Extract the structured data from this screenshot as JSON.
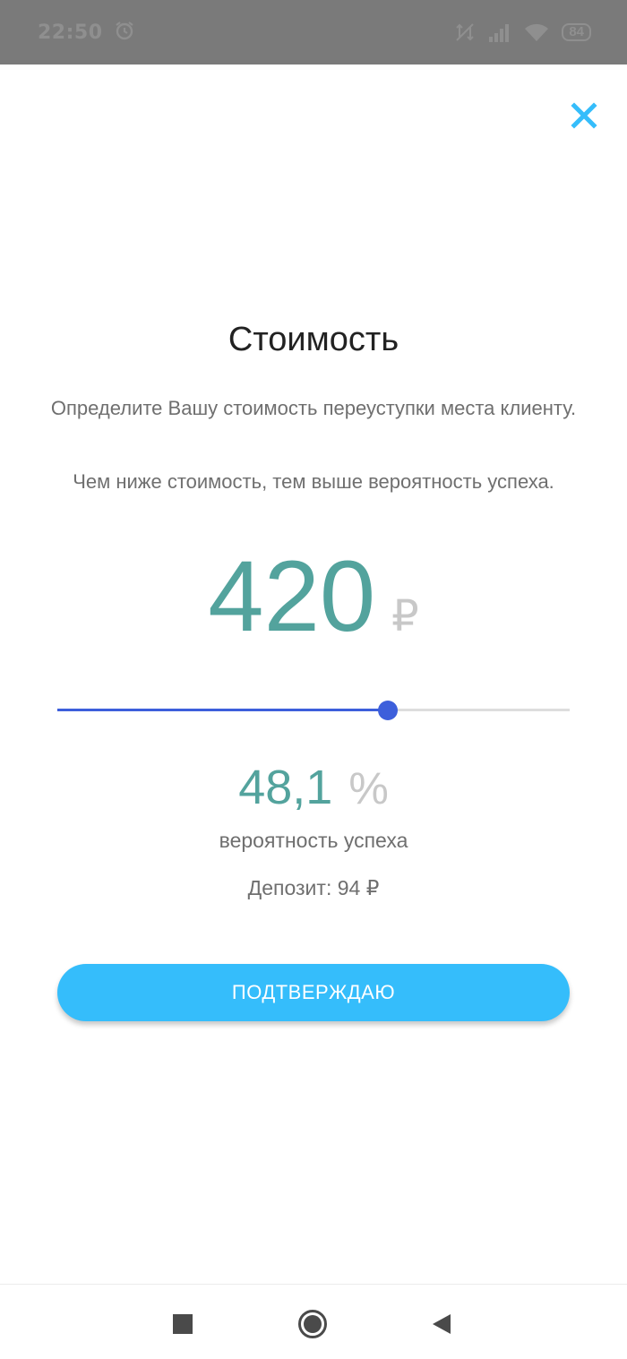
{
  "status_bar": {
    "time": "22:50",
    "battery": "84",
    "icons": [
      "alarm-icon",
      "no-data-icon",
      "signal-icon",
      "wifi-icon",
      "battery-icon"
    ]
  },
  "close": {
    "icon": "close-icon",
    "color": "#35bdfb"
  },
  "title": "Стоимость",
  "description": "Определите Вашу стоимость переуступки места клиенту.",
  "hint": "Чем ниже стоимость, тем выше вероятность успеха.",
  "price": {
    "value": "420",
    "currency": "₽"
  },
  "slider": {
    "fraction": 0.645,
    "fill_color": "#3d5fdb"
  },
  "probability": {
    "value": "48,1",
    "unit": "%",
    "label": "вероятность успеха"
  },
  "deposit": "Депозит: 94 ₽",
  "confirm_label": "ПОДТВЕРЖДАЮ",
  "colors": {
    "accent": "#35bdfb",
    "value_teal": "#53a39d"
  },
  "nav": {
    "icons": [
      "recents-square-icon",
      "home-circle-icon",
      "back-triangle-icon"
    ]
  }
}
